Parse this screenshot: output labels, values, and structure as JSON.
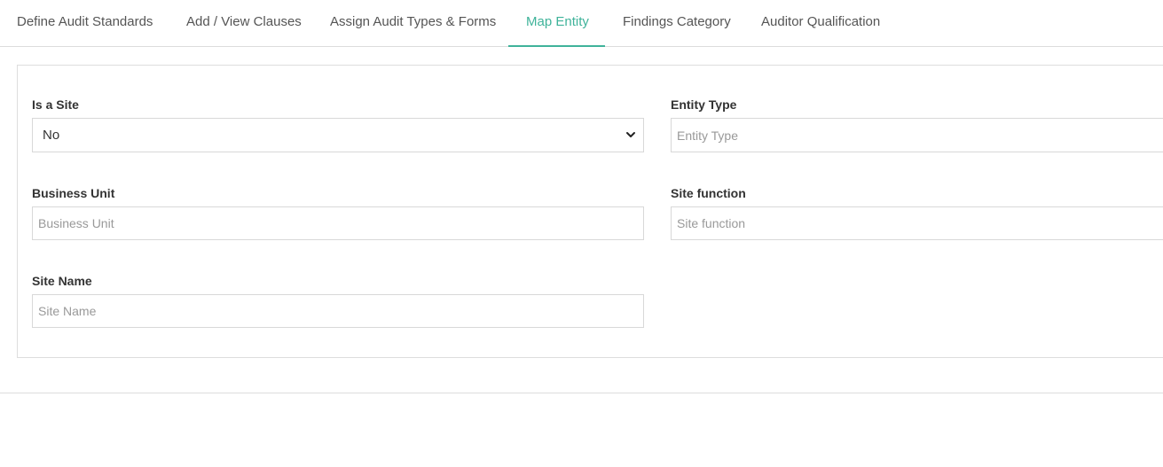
{
  "tabs": [
    {
      "label": "Define Audit Standards"
    },
    {
      "label": "Add / View Clauses"
    },
    {
      "label": "Assign Audit Types & Forms"
    },
    {
      "label": "Map Entity",
      "active": true
    },
    {
      "label": "Findings Category"
    },
    {
      "label": "Auditor Qualification"
    }
  ],
  "form": {
    "is_site": {
      "label": "Is a Site",
      "value": "No",
      "icon": "chevron-down-icon"
    },
    "entity_type": {
      "label": "Entity Type",
      "placeholder": "Entity Type"
    },
    "business_unit": {
      "label": "Business Unit",
      "placeholder": "Business Unit"
    },
    "site_function": {
      "label": "Site function",
      "placeholder": "Site function"
    },
    "site_name": {
      "label": "Site Name",
      "placeholder": "Site Name"
    }
  },
  "colors": {
    "accent": "#3fb39a",
    "border": "#d8d8d8"
  }
}
